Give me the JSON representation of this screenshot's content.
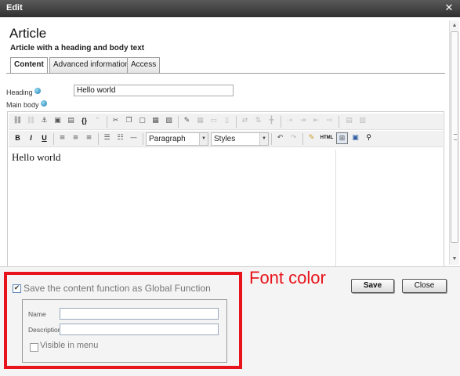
{
  "window": {
    "title": "Edit",
    "close_glyph": "✕"
  },
  "article": {
    "title": "Article",
    "subtitle": "Article with a heading and body text"
  },
  "tabs": [
    {
      "label": "Content",
      "active": true
    },
    {
      "label": "Advanced information",
      "active": false
    },
    {
      "label": "Access",
      "active": false
    }
  ],
  "fields": {
    "heading_label": "Heading",
    "heading_value": "Hello world",
    "body_label": "Main body"
  },
  "toolbar": {
    "row1_icons": [
      "link-icon",
      "unlink-icon",
      "anchor-icon",
      "image-icon",
      "media-icon",
      "code-icon",
      "quote-icon",
      "cut-icon",
      "copy-icon",
      "paste-icon",
      "paste-text-icon",
      "paste-word-icon",
      "edit-icon",
      "table-icon",
      "table-row-icon",
      "table-col-icon",
      "table-merge-icon",
      "table-split-icon",
      "insert-row-icon",
      "delete-row-icon",
      "insert-col-icon",
      "delete-col-icon"
    ],
    "bold_glyph": "B",
    "italic_glyph": "I",
    "underline_glyph": "U",
    "format_select": "Paragraph",
    "styles_select": "Styles",
    "html_glyph": "HTML"
  },
  "editor": {
    "body_text": "Hello world"
  },
  "global_function": {
    "checkbox_label": "Save the content function as Global Function",
    "checked": true,
    "name_label": "Name",
    "name_value": "",
    "description_label": "Description",
    "description_value": "",
    "visible_label": "Visible in menu",
    "visible_checked": false
  },
  "annotation": {
    "text": "Font color",
    "color": "#e8141b"
  },
  "buttons": {
    "save": "Save",
    "close": "Close"
  },
  "colors": {
    "titlebar": "#3c3c3c",
    "highlight_box": "#e8141b"
  }
}
